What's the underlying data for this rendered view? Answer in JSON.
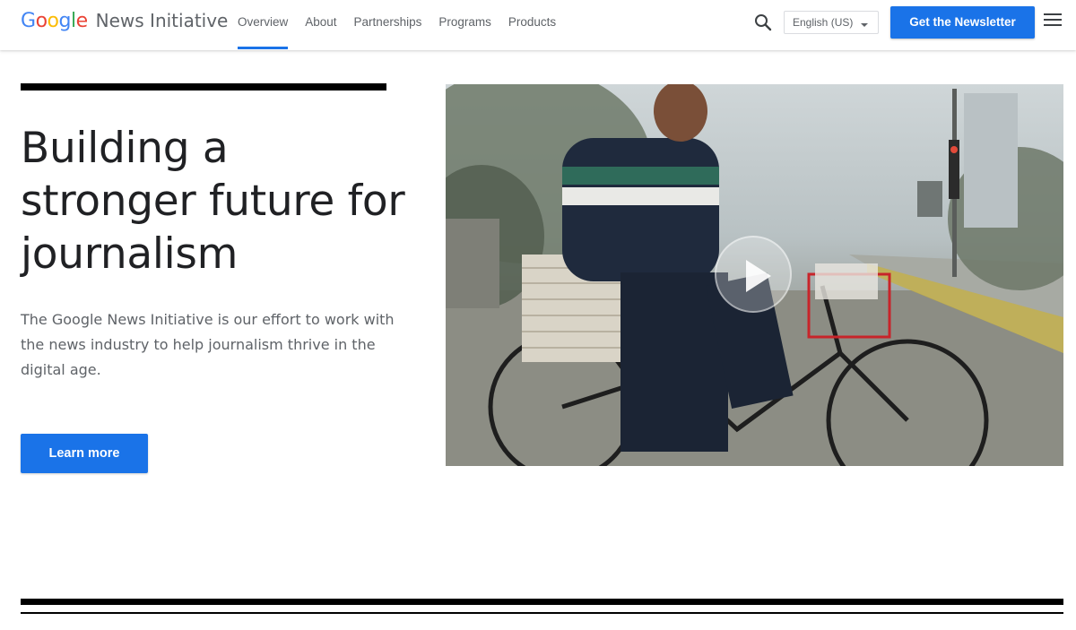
{
  "brand": {
    "google_letters": [
      "G",
      "o",
      "o",
      "g",
      "l",
      "e"
    ],
    "product": "News Initiative"
  },
  "nav": {
    "items": [
      {
        "label": "Overview",
        "active": true
      },
      {
        "label": "About",
        "active": false
      },
      {
        "label": "Partnerships",
        "active": false
      },
      {
        "label": "Programs",
        "active": false
      },
      {
        "label": "Products",
        "active": false
      }
    ]
  },
  "header": {
    "search_icon": "search-icon",
    "language": "English (US)",
    "newsletter_label": "Get the Newsletter",
    "menu_icon": "hamburger-menu-icon"
  },
  "hero": {
    "headline": "Building a stronger future for journalism",
    "body": "The Google News Initiative is our effort to work with the news industry to help journalism thrive in the digital age.",
    "cta_label": "Learn more",
    "video_icon": "play-icon"
  },
  "colors": {
    "accent": "#1a73e8",
    "text_primary": "#202124",
    "text_secondary": "#5f6368",
    "rule": "#000000"
  }
}
